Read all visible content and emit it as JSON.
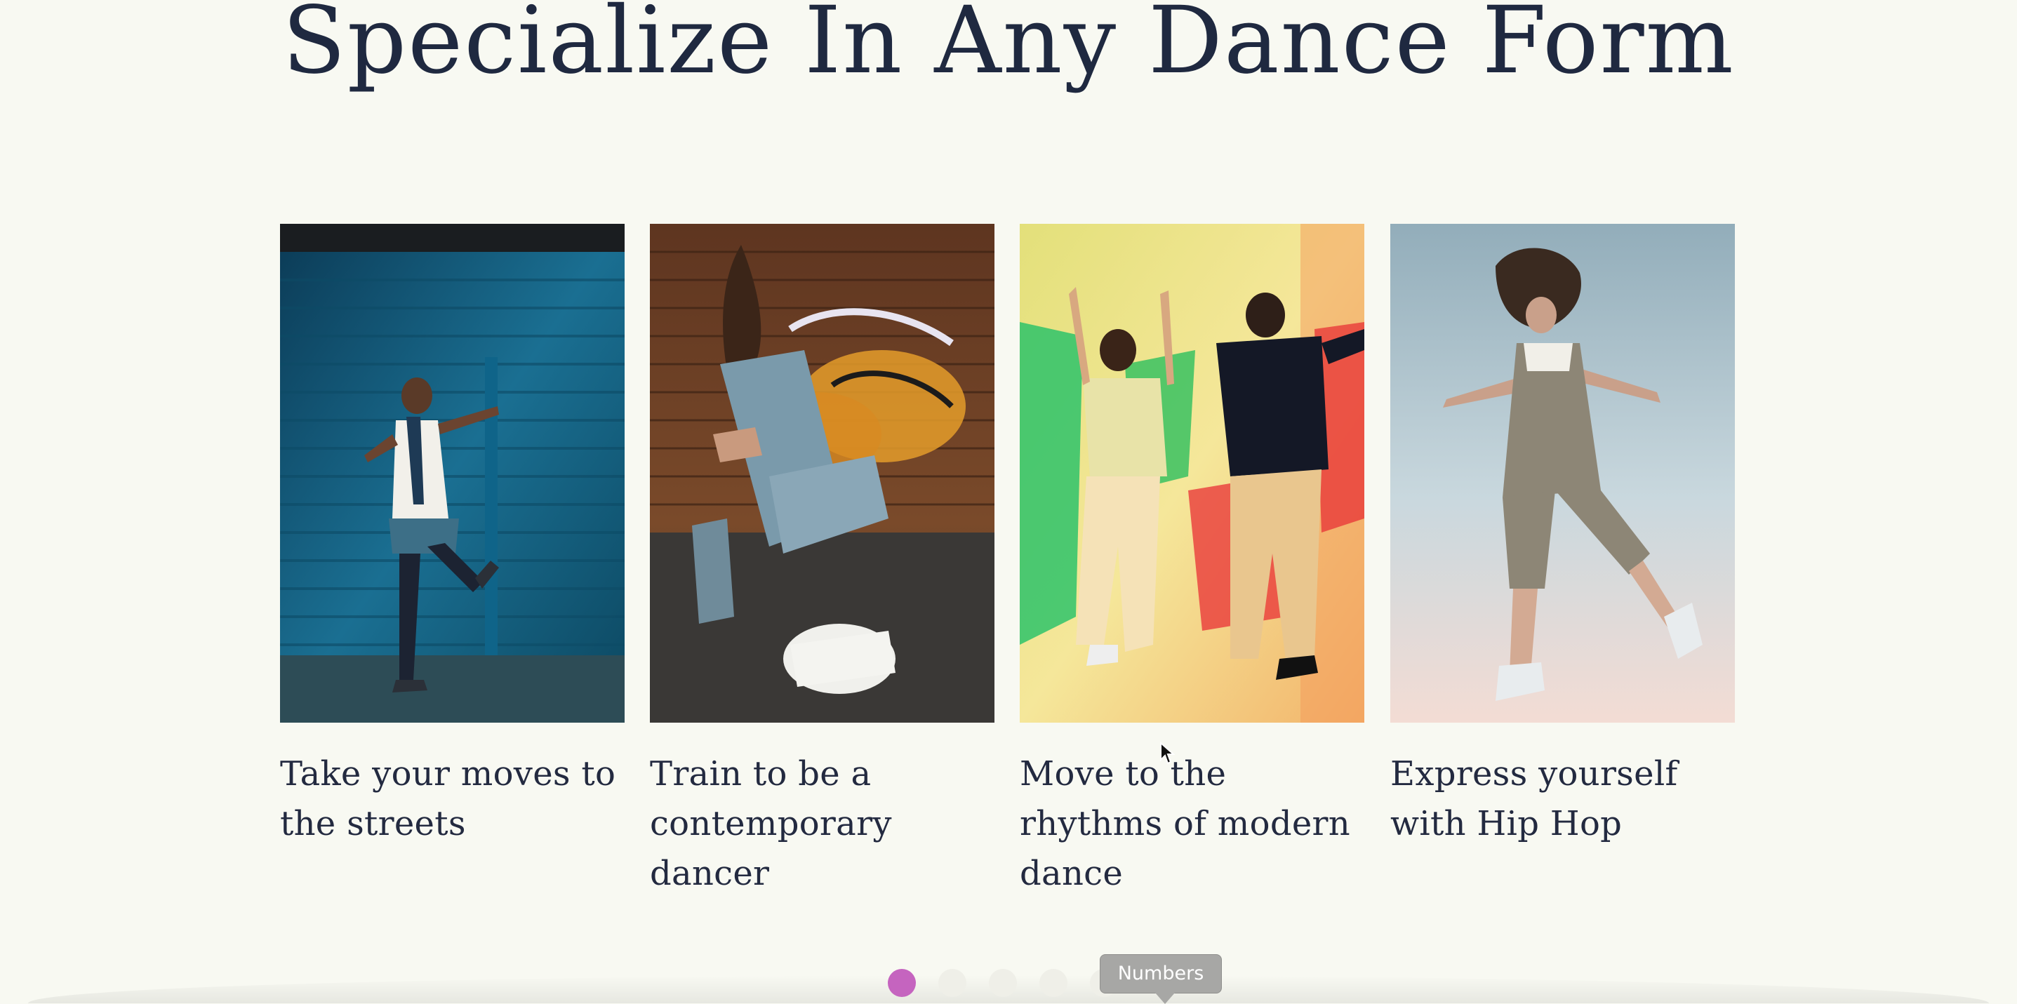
{
  "section": {
    "title": "Specialize In Any Dance Form"
  },
  "cards": [
    {
      "caption": "Take your moves to the streets",
      "image_icon": "street-dancer-photo"
    },
    {
      "caption": "Train to be a contemporary dancer",
      "image_icon": "contemporary-dancer-photo"
    },
    {
      "caption": "Move to the rhythms of modern dance",
      "image_icon": "modern-dance-duo-photo"
    },
    {
      "caption": "Express yourself with Hip Hop",
      "image_icon": "hip-hop-jump-photo"
    }
  ],
  "carousel": {
    "dot_count": 5,
    "active_index": 0,
    "active_color": "#c564bf",
    "inactive_color": "#efefe8"
  },
  "tooltip": {
    "text": "Numbers"
  },
  "colors": {
    "background": "#f8f9f2",
    "heading": "#1f2940"
  }
}
